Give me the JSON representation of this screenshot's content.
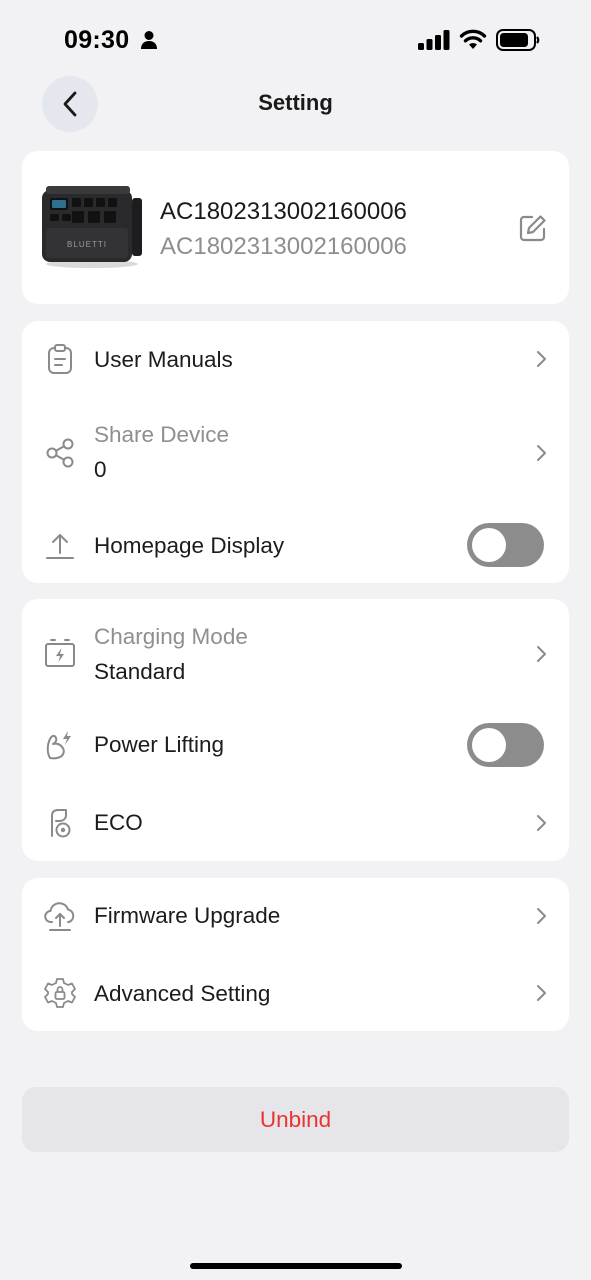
{
  "status_bar": {
    "time": "09:30",
    "icons": [
      "person-icon",
      "signal-icon",
      "wifi-icon",
      "battery-icon"
    ]
  },
  "nav": {
    "title": "Setting",
    "back_icon": "chevron-left-icon"
  },
  "device": {
    "name": "AC1802313002160006",
    "serial": "AC1802313002160006",
    "image_brand": "BLUETTI",
    "edit_icon": "edit-icon"
  },
  "section1": {
    "user_manuals": {
      "label": "User Manuals",
      "icon": "clipboard-icon"
    },
    "share_device": {
      "label": "Share Device",
      "value": "0",
      "icon": "share-icon"
    },
    "homepage_display": {
      "label": "Homepage Display",
      "icon": "upload-icon",
      "enabled": false
    }
  },
  "section2": {
    "charging_mode": {
      "label": "Charging Mode",
      "value": "Standard",
      "icon": "battery-charge-icon"
    },
    "power_lifting": {
      "label": "Power Lifting",
      "icon": "muscle-bolt-icon",
      "enabled": false
    },
    "eco": {
      "label": "ECO",
      "icon": "eco-icon"
    }
  },
  "section3": {
    "firmware_upgrade": {
      "label": "Firmware Upgrade",
      "icon": "cloud-upload-icon"
    },
    "advanced_setting": {
      "label": "Advanced Setting",
      "icon": "gear-lock-icon"
    }
  },
  "unbind": {
    "label": "Unbind"
  },
  "colors": {
    "background": "#f2f2f5",
    "card": "#ffffff",
    "toggle_off": "#8c8c8c",
    "danger": "#e8352f",
    "muted_text": "#8f8f8f",
    "back_button_bg": "#e4e7ee"
  }
}
